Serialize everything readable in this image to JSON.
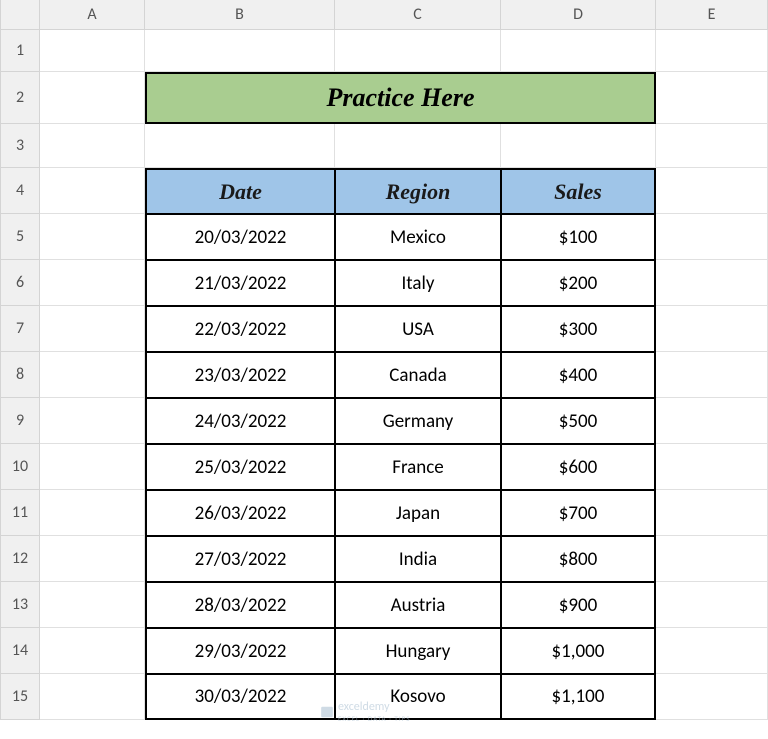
{
  "columns": [
    "A",
    "B",
    "C",
    "D",
    "E"
  ],
  "rows": [
    "1",
    "2",
    "3",
    "4",
    "5",
    "6",
    "7",
    "8",
    "9",
    "10",
    "11",
    "12",
    "13",
    "14",
    "15"
  ],
  "title": "Practice Here",
  "headers": {
    "date": "Date",
    "region": "Region",
    "sales": "Sales"
  },
  "data": [
    {
      "date": "20/03/2022",
      "region": "Mexico",
      "sales": "$100"
    },
    {
      "date": "21/03/2022",
      "region": "Italy",
      "sales": "$200"
    },
    {
      "date": "22/03/2022",
      "region": "USA",
      "sales": "$300"
    },
    {
      "date": "23/03/2022",
      "region": "Canada",
      "sales": "$400"
    },
    {
      "date": "24/03/2022",
      "region": "Germany",
      "sales": "$500"
    },
    {
      "date": "25/03/2022",
      "region": "France",
      "sales": "$600"
    },
    {
      "date": "26/03/2022",
      "region": "Japan",
      "sales": "$700"
    },
    {
      "date": "27/03/2022",
      "region": "India",
      "sales": "$800"
    },
    {
      "date": "28/03/2022",
      "region": "Austria",
      "sales": "$900"
    },
    {
      "date": "29/03/2022",
      "region": "Hungary",
      "sales": "$1,000"
    },
    {
      "date": "30/03/2022",
      "region": "Kosovo",
      "sales": "$1,100"
    }
  ],
  "watermark": {
    "name": "exceldemy",
    "tag": "EXCEL · DATA · TIPS"
  }
}
